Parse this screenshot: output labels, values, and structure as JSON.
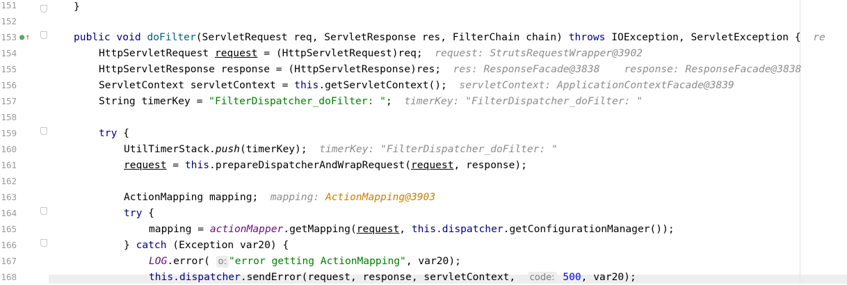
{
  "gutter": {
    "line_numbers": [
      "151",
      "152",
      "153",
      "154",
      "155",
      "156",
      "157",
      "158",
      "159",
      "160",
      "161",
      "162",
      "163",
      "164",
      "165",
      "166",
      "167",
      "168"
    ]
  },
  "code": {
    "l151": {
      "brace": "}"
    },
    "l153": {
      "kw_public": "public",
      "kw_void": "void",
      "method": "doFilter",
      "params": "(ServletRequest req, ServletResponse res, FilterChain chain)",
      "kw_throws": "throws",
      "tail": "IOException, ServletException {",
      "hint": "re"
    },
    "l154": {
      "type": "HttpServletRequest",
      "var": "request",
      "rest": " = (HttpServletRequest)req;",
      "hint": "request: StrutsRequestWrapper@3902"
    },
    "l155": {
      "code": "HttpServletResponse response = (HttpServletResponse)res;",
      "hint1": "res: ResponseFacade@3838",
      "hint2": "response: ResponseFacade@3838"
    },
    "l156": {
      "pre": "ServletContext servletContext = ",
      "kw_this": "this",
      "post": ".getServletContext();",
      "hint": "servletContext: ApplicationContextFacade@3839"
    },
    "l157": {
      "pre": "String timerKey = ",
      "str": "\"FilterDispatcher_doFilter: \"",
      "post": ";",
      "hint": "timerKey: \"FilterDispatcher_doFilter: \""
    },
    "l159": {
      "kw_try": "try",
      "post": " {"
    },
    "l160": {
      "pre": "UtilTimerStack.",
      "method": "push",
      "post": "(timerKey);",
      "hint": "timerKey: \"FilterDispatcher_doFilter: \""
    },
    "l161": {
      "var": "request",
      "eq": " = ",
      "kw_this": "this",
      "mid": ".prepareDispatcherAndWrapRequest(",
      "arg": "request",
      "post": ", response);"
    },
    "l163": {
      "code": "ActionMapping mapping;",
      "hint_label": "mapping:",
      "hint_value": "ActionMapping@3903"
    },
    "l164": {
      "kw_try": "try",
      "post": " {"
    },
    "l165": {
      "pre": "mapping = ",
      "field": "actionMapper",
      "mid": ".getMapping(",
      "arg": "request",
      "comma": ", ",
      "kw_this": "this",
      "field2": ".dispatcher",
      "post": ".getConfigurationManager());"
    },
    "l166": {
      "pre": "} ",
      "kw_catch": "catch",
      "post": " (Exception var20) {"
    },
    "l167": {
      "field": "LOG",
      "mid": ".error(",
      "param_hint": "o:",
      "str": "\"error getting ActionMapping\"",
      "post": ", var20);"
    },
    "l168": {
      "kw_this": "this",
      "field": ".dispatcher",
      "mid": ".sendError(request, response, servletContext,",
      "param_hint": "code:",
      "num": "500",
      "post": ", var20);"
    }
  },
  "colors": {
    "keyword": "#000080",
    "string": "#008000",
    "hint": "#8c8c8c",
    "field": "#660e7a",
    "hint_orange": "#c77f00"
  }
}
